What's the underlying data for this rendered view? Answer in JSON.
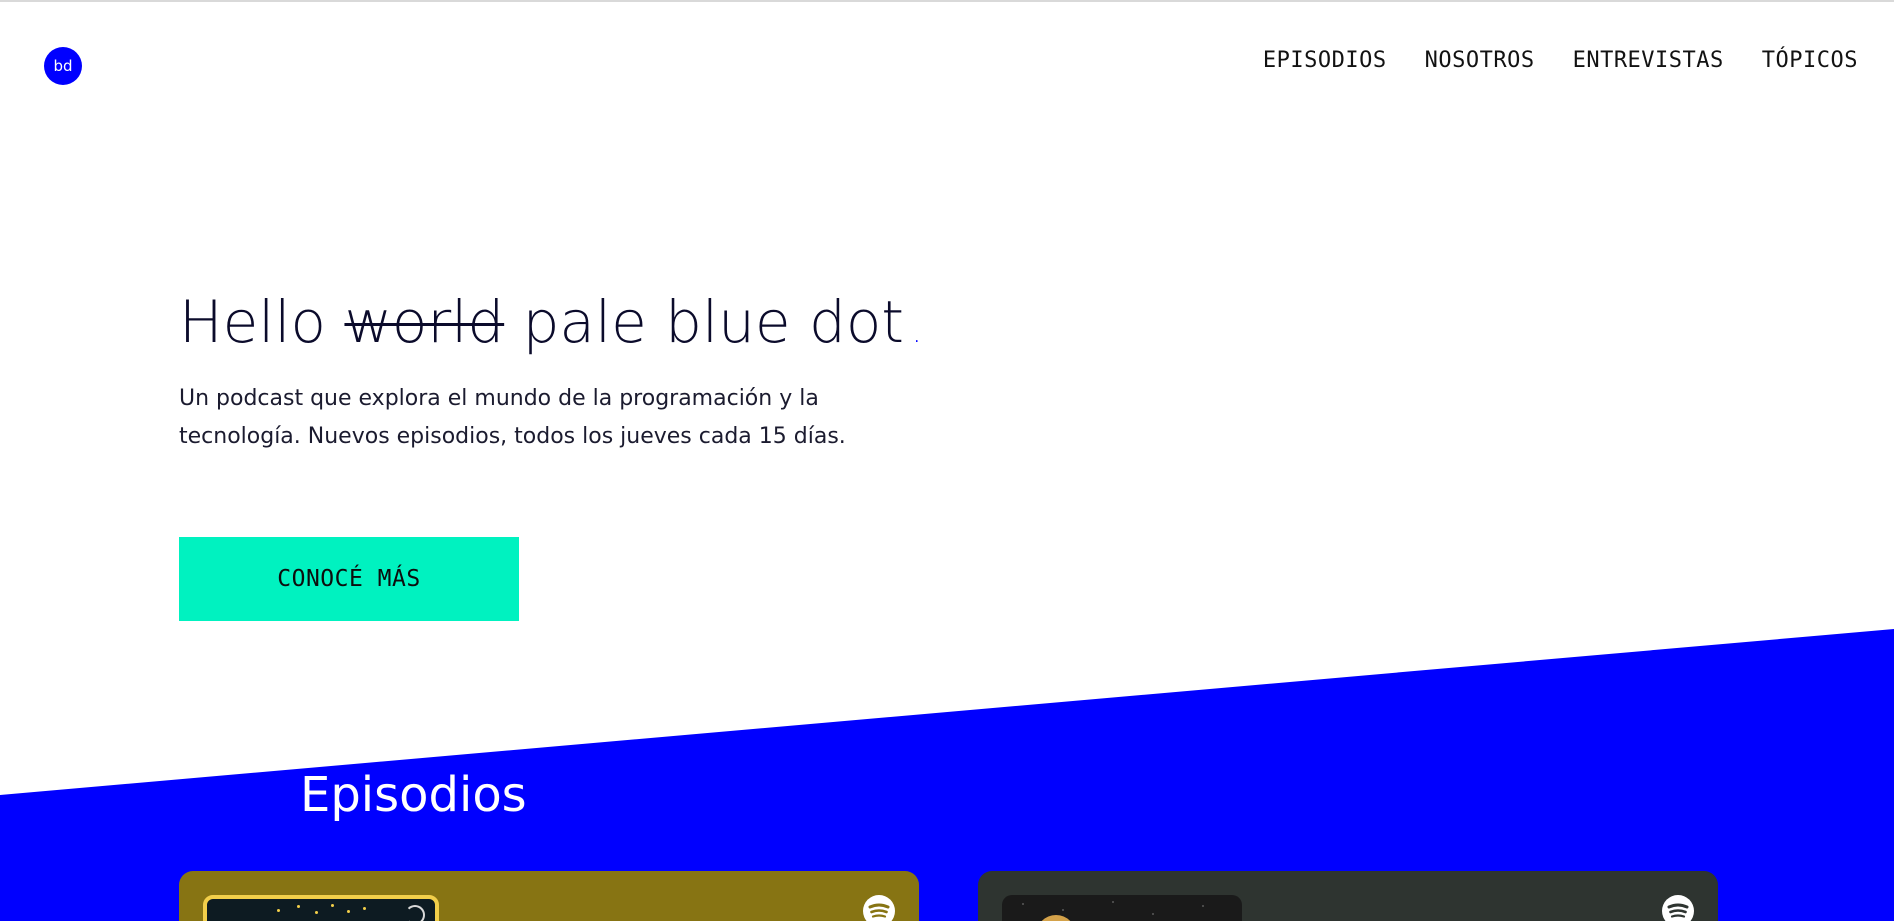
{
  "logo": {
    "text": "bd"
  },
  "nav": {
    "items": [
      {
        "label": "EPISODIOS"
      },
      {
        "label": "NOSOTROS"
      },
      {
        "label": "ENTREVISTAS"
      },
      {
        "label": "TÓPICOS"
      }
    ]
  },
  "hero": {
    "title_before": "Hello",
    "title_struck": "world",
    "title_after": "pale blue dot",
    "title_dot": ".",
    "subtitle": "Un podcast que explora el mundo de la programación y la tecnología. Nuevos episodios, todos los jueves cada 15 días.",
    "cta_label": "CONOCÉ MÁS"
  },
  "episodes": {
    "title": "Episodios",
    "cards": [
      {
        "icon": "spotify-icon",
        "color": "#877413"
      },
      {
        "icon": "spotify-icon",
        "color": "#2e3430"
      }
    ]
  },
  "colors": {
    "accent_blue": "#0000ff",
    "cta_mint": "#00f2c0",
    "text_dark": "#0b0b2b"
  }
}
